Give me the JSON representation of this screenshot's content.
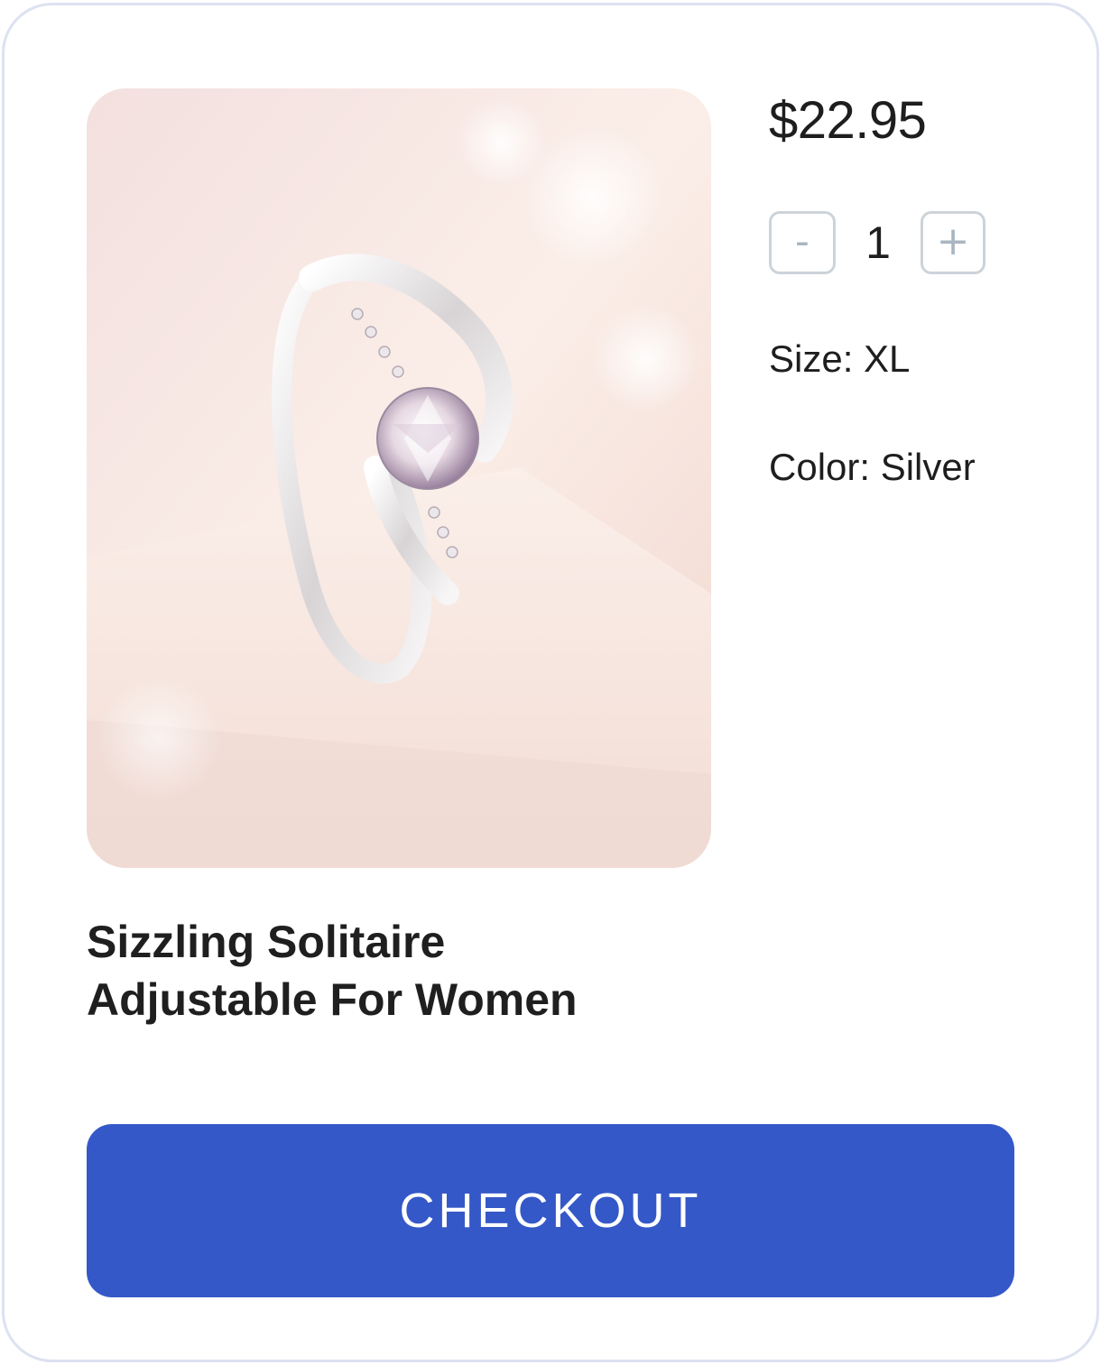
{
  "product": {
    "price": "$22.95",
    "title_line1": "Sizzling Solitaire",
    "title_line2": "Adjustable For Women",
    "size_label": "Size: XL",
    "color_label": "Color: Silver",
    "image_icon": "ring-product-photo"
  },
  "quantity": {
    "decrement_label": "-",
    "value": "1",
    "increment_label": "+"
  },
  "actions": {
    "checkout_label": "CHECKOUT"
  },
  "colors": {
    "accent": "#3558c8",
    "card_border": "#dde2f1",
    "stepper_border": "#ccd3d9"
  }
}
